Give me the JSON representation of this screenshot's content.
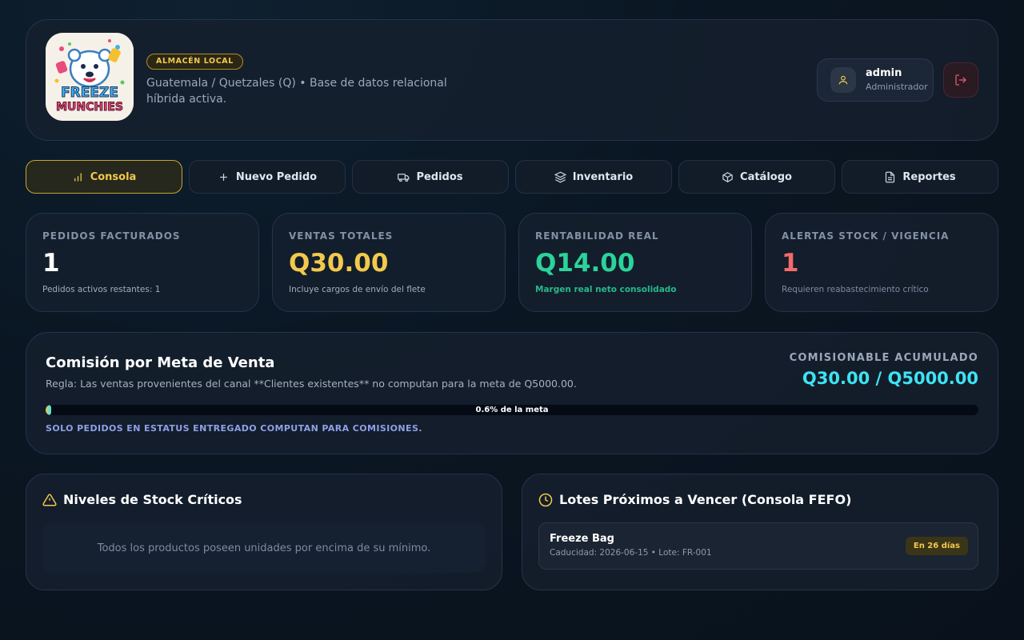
{
  "header": {
    "logo_text": [
      "FREEZE",
      "MUNCHIES"
    ],
    "badge": "ALMACÉN LOCAL",
    "subtitle": "Guatemala / Quetzales (Q) • Base de datos relacional híbrida activa.",
    "user": {
      "name": "admin",
      "role": "Administrador"
    }
  },
  "tabs": [
    {
      "label": "Consola",
      "icon": "bar-chart-icon",
      "active": true
    },
    {
      "label": "Nuevo Pedido",
      "icon": "plus-icon"
    },
    {
      "label": "Pedidos",
      "icon": "truck-icon"
    },
    {
      "label": "Inventario",
      "icon": "layers-icon"
    },
    {
      "label": "Catálogo",
      "icon": "box-icon"
    },
    {
      "label": "Reportes",
      "icon": "file-icon"
    }
  ],
  "stats": [
    {
      "label": "PEDIDOS FACTURADOS",
      "value": "1",
      "note": "Pedidos activos restantes: 1",
      "color": "#ffffff",
      "note_color": "#a3aebc"
    },
    {
      "label": "VENTAS TOTALES",
      "value": "Q30.00",
      "note": "Incluye cargos de envío del flete",
      "color": "#f2c94c",
      "note_color": "#a3aebc"
    },
    {
      "label": "RENTABILIDAD REAL",
      "value": "Q14.00",
      "note": "Margen real neto consolidado",
      "color": "#2bd39a",
      "note_color": "#27b98a"
    },
    {
      "label": "ALERTAS STOCK / VIGENCIA",
      "value": "1",
      "note": "Requieren reabastecimiento crítico",
      "color": "#f26b6b",
      "note_color": "#7f8ba0"
    }
  ],
  "commission": {
    "title": "Comisión por Meta de Venta",
    "rule": "Regla: Las ventas provenientes del canal **Clientes existentes** no computan para la meta de Q5000.00.",
    "accumulated_label": "COMISIONABLE ACUMULADO",
    "accumulated_value": "Q30.00 / Q5000.00",
    "progress_percent": 0.6,
    "progress_label": "0.6% de la meta",
    "note": "SOLO PEDIDOS EN ESTATUS ENTREGADO COMPUTAN PARA COMISIONES."
  },
  "stock_panel": {
    "title": "Niveles de Stock Críticos",
    "empty_text": "Todos los productos poseen unidades por encima de su mínimo."
  },
  "fefo_panel": {
    "title": "Lotes Próximos a Vencer (Consola FEFO)",
    "lot": {
      "name": "Freeze Bag",
      "meta": "Caducidad: 2026-06-15 • Lote: FR-001",
      "badge": "En 26 días"
    }
  },
  "colors": {
    "accent": "#f2c94c",
    "cyan": "#3ee3f2",
    "green": "#2bd39a",
    "red": "#f26b6b"
  }
}
